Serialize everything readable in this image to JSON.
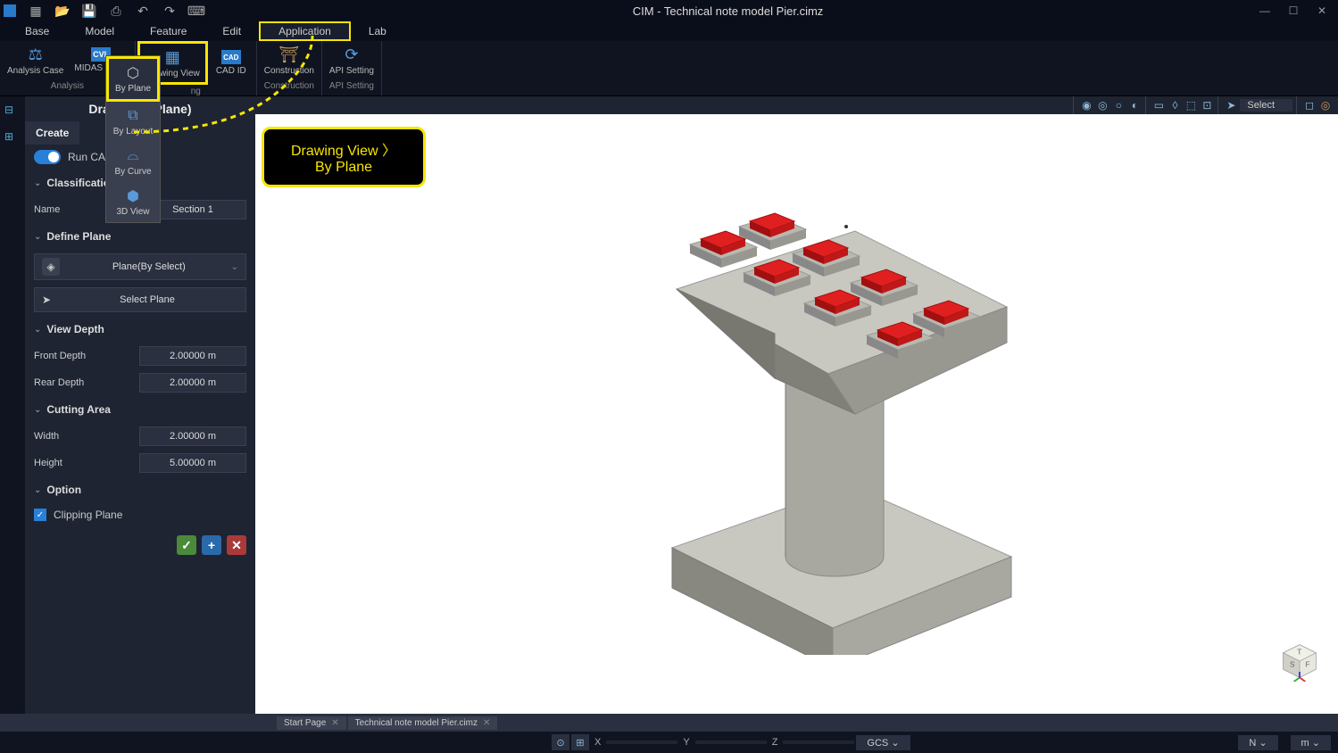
{
  "titlebar": {
    "title": "CIM - Technical note model Pier.cimz"
  },
  "menubar": {
    "items": [
      "Base",
      "Model",
      "Feature",
      "Edit",
      "Application",
      "Lab"
    ],
    "highlighted_index": 4
  },
  "ribbon": {
    "groups": [
      {
        "label": "Analysis",
        "buttons": [
          {
            "label": "Analysis Case",
            "name": "analysis-case-button"
          },
          {
            "label": "MIDAS CIVIL",
            "name": "midas-civil-button"
          }
        ]
      },
      {
        "label": "ng",
        "buttons": [
          {
            "label": "Drawing View",
            "name": "drawing-view-button",
            "highlighted": true
          },
          {
            "label": "CAD ID",
            "name": "cad-id-button"
          }
        ]
      },
      {
        "label": "Construction",
        "buttons": [
          {
            "label": "Construction",
            "name": "construction-button"
          }
        ]
      },
      {
        "label": "API Setting",
        "buttons": [
          {
            "label": "API Setting",
            "name": "api-setting-button"
          }
        ]
      }
    ]
  },
  "dropdown": {
    "items": [
      {
        "label": "By Plane",
        "name": "by-plane-option",
        "highlighted": true
      },
      {
        "label": "By Layout",
        "name": "by-layout-option"
      },
      {
        "label": "By Curve",
        "name": "by-curve-option"
      },
      {
        "label": "3D View",
        "name": "3d-view-option"
      }
    ]
  },
  "callout": {
    "line1": "Drawing View 〉",
    "line2": "By Plane"
  },
  "panel": {
    "title": "Draw          Plane)",
    "tab": "Create",
    "run_cad_label": "Run CAD",
    "sections": {
      "classification": {
        "title": "Classification",
        "name_label": "Name",
        "name_value": "Section 1"
      },
      "define_plane": {
        "title": "Define Plane",
        "method": "Plane(By Select)",
        "select_btn": "Select Plane"
      },
      "view_depth": {
        "title": "View Depth",
        "front_label": "Front Depth",
        "front_value": "2.00000 m",
        "rear_label": "Rear Depth",
        "rear_value": "2.00000 m"
      },
      "cutting_area": {
        "title": "Cutting Area",
        "width_label": "Width",
        "width_value": "2.00000 m",
        "height_label": "Height",
        "height_value": "5.00000 m"
      },
      "option": {
        "title": "Option",
        "clipping_label": "Clipping Plane"
      }
    }
  },
  "viewport": {
    "select_label": "Select"
  },
  "tabs": [
    {
      "label": "Start Page"
    },
    {
      "label": "Technical note model Pier.cimz"
    }
  ],
  "statusbar": {
    "x": "X",
    "y": "Y",
    "z": "Z",
    "gcs": "GCS",
    "n": "N",
    "m": "m"
  }
}
